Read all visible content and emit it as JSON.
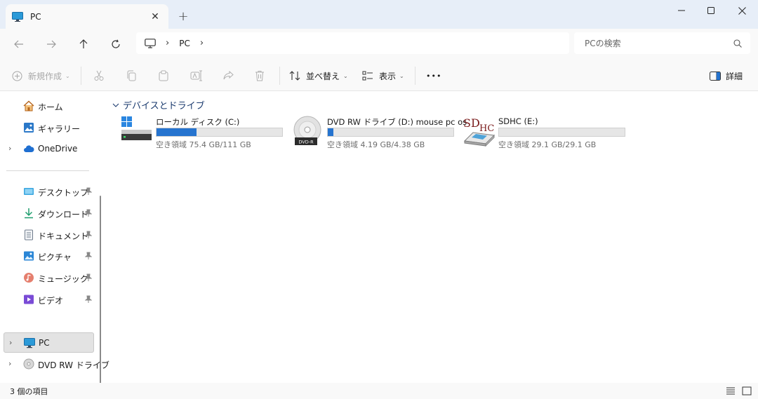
{
  "tab": {
    "title": "PC",
    "close_glyph": "✕",
    "new_tab_glyph": "+"
  },
  "window": {
    "minimize_icon": "minimize-icon",
    "maximize_icon": "maximize-icon",
    "close_icon": "close-icon"
  },
  "address": {
    "items": [
      "PC"
    ],
    "root_icon": "computer-icon"
  },
  "search": {
    "placeholder": "PCの検索"
  },
  "toolbar": {
    "new": "新規作成",
    "sort": "並べ替え",
    "view": "表示",
    "more": "•••",
    "details": "詳細"
  },
  "sidebar": {
    "home": "ホーム",
    "gallery": "ギャラリー",
    "onedrive": "OneDrive",
    "desktop": "デスクトップ",
    "downloads": "ダウンロード",
    "documents": "ドキュメント",
    "pictures": "ピクチャ",
    "music": "ミュージック",
    "videos": "ビデオ",
    "pc": "PC",
    "dvd": "DVD RW ドライブ"
  },
  "main": {
    "group_title": "デバイスとドライブ",
    "drives": [
      {
        "name": "ローカル ディスク (C:)",
        "free": "空き領域 75.4 GB/111 GB",
        "used_fraction": 0.32
      },
      {
        "name": "DVD RW ドライブ (D:) mouse pc os",
        "free": "空き領域 4.19 GB/4.38 GB",
        "used_fraction": 0.043
      },
      {
        "name": "SDHC (E:)",
        "free": "空き領域 29.1 GB/29.1 GB",
        "used_fraction": 0.0
      }
    ],
    "dvd_badge": "DVD-R",
    "sd_logo_sd": "SD",
    "sd_logo_hc": "HC"
  },
  "status": {
    "items_count": "3 個の項目"
  },
  "colors": {
    "accent": "#2674cf",
    "titlebar": "#e7eef8",
    "selected": "#e3e3e3"
  }
}
